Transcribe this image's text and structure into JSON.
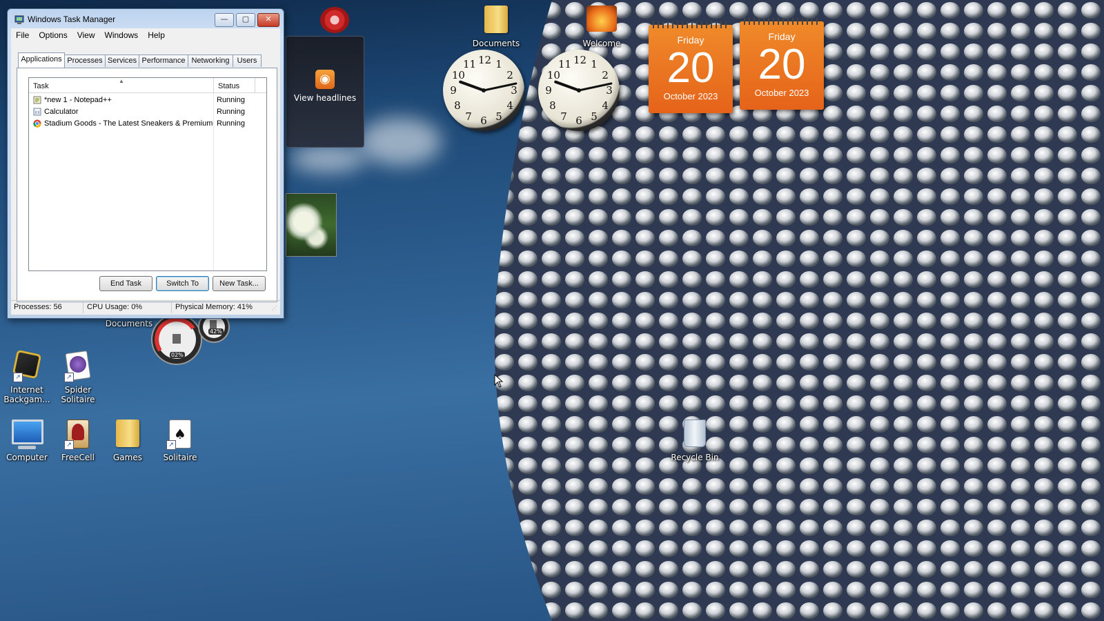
{
  "taskmgr": {
    "title": "Windows Task Manager",
    "caption": {
      "minimize": "—",
      "maximize": "▢",
      "close": "✕"
    },
    "menu": [
      "File",
      "Options",
      "View",
      "Windows",
      "Help"
    ],
    "tabs": [
      "Applications",
      "Processes",
      "Services",
      "Performance",
      "Networking",
      "Users"
    ],
    "active_tab": "Applications",
    "columns": {
      "task": "Task",
      "status": "Status"
    },
    "rows": [
      {
        "task": "*new 1 - Notepad++",
        "status": "Running",
        "icon": "notepad-icon"
      },
      {
        "task": "Calculator",
        "status": "Running",
        "icon": "calculator-icon"
      },
      {
        "task": "Stadium Goods - The Latest Sneakers & Premium...",
        "status": "Running",
        "icon": "chrome-icon"
      }
    ],
    "buttons": {
      "end_task": "End Task",
      "switch_to": "Switch To",
      "new_task": "New Task..."
    },
    "status": {
      "processes": "Processes: 56",
      "cpu": "CPU Usage: 0%",
      "memory": "Physical Memory: 41%"
    }
  },
  "desktop": {
    "icons": [
      {
        "label": "Documents",
        "icon": "folder-icon"
      },
      {
        "label": "Welcome",
        "icon": "welcome-icon"
      },
      {
        "label": "Internet Backgam...",
        "icon": "internet-backgammon-icon"
      },
      {
        "label": "Spider Solitaire",
        "icon": "spider-solitaire-icon"
      },
      {
        "label": "Computer",
        "icon": "computer-icon"
      },
      {
        "label": "FreeCell",
        "icon": "freecell-icon"
      },
      {
        "label": "Games",
        "icon": "folder-icon"
      },
      {
        "label": "Solitaire",
        "icon": "solitaire-icon"
      },
      {
        "label": "Recycle Bin",
        "icon": "recycle-bin-icon"
      },
      {
        "label": "Documents",
        "icon": "partially-hidden-icon"
      }
    ]
  },
  "gadgets": {
    "headlines": {
      "label": "View headlines",
      "icon": "rss-icon"
    },
    "clock": {
      "numbers": [
        "12",
        "1",
        "2",
        "3",
        "4",
        "5",
        "6",
        "7",
        "8",
        "9",
        "10",
        "11"
      ]
    },
    "calendars": [
      {
        "weekday": "Friday",
        "day": "20",
        "month_year": "October 2023"
      },
      {
        "weekday": "Friday",
        "day": "20",
        "month_year": "October 2023"
      }
    ],
    "meter": {
      "cpu": "02%",
      "memory": "42%"
    }
  }
}
